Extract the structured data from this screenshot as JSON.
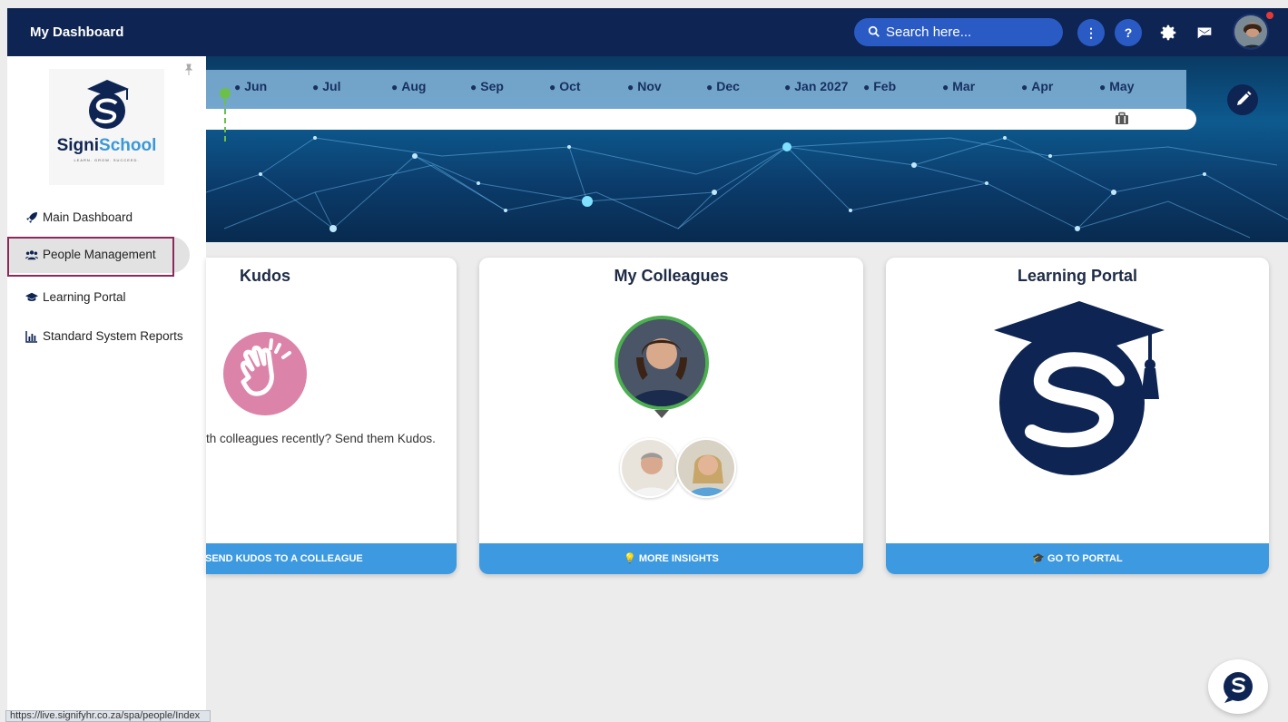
{
  "topbar": {
    "title": "My Dashboard",
    "search_placeholder": "Search here..."
  },
  "timeline": {
    "months": [
      "Jun",
      "Jul",
      "Aug",
      "Sep",
      "Oct",
      "Nov",
      "Dec",
      "Jan 2027",
      "Feb",
      "Mar",
      "Apr",
      "May"
    ]
  },
  "sidebar": {
    "logo_name_part1": "Signi",
    "logo_name_part2": "School",
    "logo_tagline": "LEARN. GROW. SUCCEED.",
    "items": [
      {
        "label": "Main Dashboard",
        "icon": "rocket-icon"
      },
      {
        "label": "People Management",
        "icon": "users-icon",
        "active": true
      },
      {
        "label": "Learning Portal",
        "icon": "graduation-cap-icon"
      },
      {
        "label": "Standard System Reports",
        "icon": "bar-chart-icon"
      }
    ]
  },
  "status_bar": {
    "url": "https://live.signifyhr.co.za/spa/people/Index"
  },
  "cards": {
    "kudos": {
      "title": "Kudos",
      "text": "th colleagues recently? Send them Kudos.",
      "button": "SEND KUDOS TO A COLLEAGUE"
    },
    "colleagues": {
      "title": "My Colleagues",
      "button": "MORE INSIGHTS"
    },
    "learning": {
      "title": "Learning Portal",
      "button": "GO TO PORTAL"
    }
  },
  "colors": {
    "topbar": "#0e2452",
    "accent": "#3d9ae0",
    "kudos_pink": "#dc83aa",
    "active_outline": "#8a2a5c",
    "online_green": "#4caf50"
  }
}
